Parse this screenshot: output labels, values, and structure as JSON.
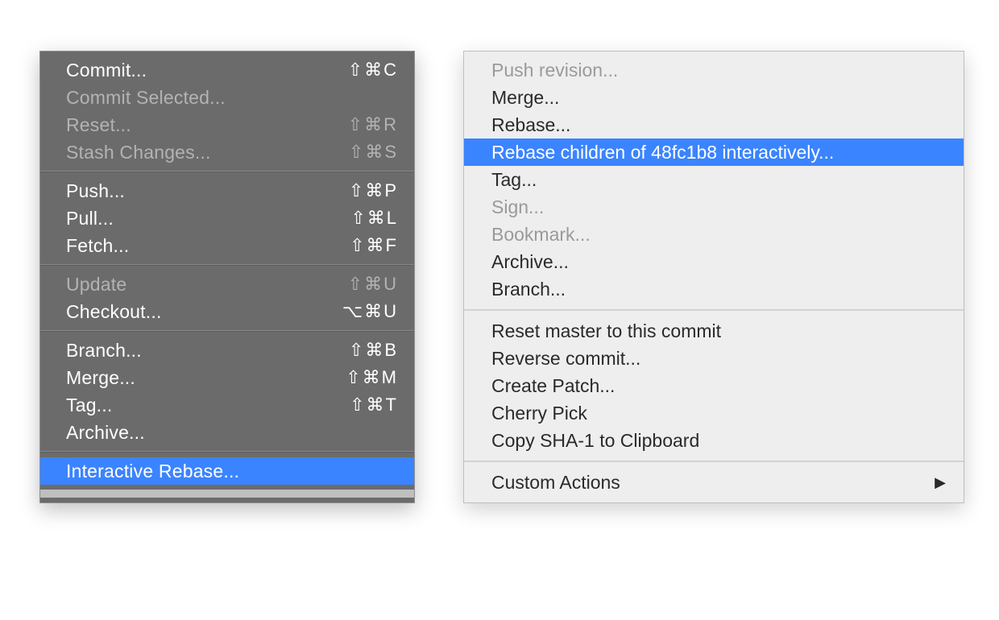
{
  "leftMenu": {
    "groups": [
      [
        {
          "key": "commit",
          "label": "Commit...",
          "shortcut": "⇧⌘C",
          "disabled": false
        },
        {
          "key": "commit-selected",
          "label": "Commit Selected...",
          "shortcut": "",
          "disabled": true
        },
        {
          "key": "reset",
          "label": "Reset...",
          "shortcut": "⇧⌘R",
          "disabled": true
        },
        {
          "key": "stash-changes",
          "label": "Stash Changes...",
          "shortcut": "⇧⌘S",
          "disabled": true
        }
      ],
      [
        {
          "key": "push",
          "label": "Push...",
          "shortcut": "⇧⌘P",
          "disabled": false
        },
        {
          "key": "pull",
          "label": "Pull...",
          "shortcut": "⇧⌘L",
          "disabled": false
        },
        {
          "key": "fetch",
          "label": "Fetch...",
          "shortcut": "⇧⌘F",
          "disabled": false
        }
      ],
      [
        {
          "key": "update",
          "label": "Update",
          "shortcut": "⇧⌘U",
          "disabled": true
        },
        {
          "key": "checkout",
          "label": "Checkout...",
          "shortcut": "⌥⌘U",
          "disabled": false
        }
      ],
      [
        {
          "key": "branch",
          "label": "Branch...",
          "shortcut": "⇧⌘B",
          "disabled": false
        },
        {
          "key": "merge",
          "label": "Merge...",
          "shortcut": "⇧⌘M",
          "disabled": false
        },
        {
          "key": "tag",
          "label": "Tag...",
          "shortcut": "⇧⌘T",
          "disabled": false
        },
        {
          "key": "archive",
          "label": "Archive...",
          "shortcut": "",
          "disabled": false
        }
      ],
      [
        {
          "key": "interactive-rebase",
          "label": "Interactive Rebase...",
          "shortcut": "",
          "disabled": false,
          "selected": true
        }
      ]
    ]
  },
  "rightMenu": {
    "groups": [
      [
        {
          "key": "push-revision",
          "label": "Push revision...",
          "disabled": true
        },
        {
          "key": "merge",
          "label": "Merge...",
          "disabled": false
        },
        {
          "key": "rebase",
          "label": "Rebase...",
          "disabled": false
        },
        {
          "key": "rebase-children-interactive",
          "label": "Rebase children of 48fc1b8 interactively...",
          "disabled": false,
          "selected": true
        },
        {
          "key": "tag",
          "label": "Tag...",
          "disabled": false
        },
        {
          "key": "sign",
          "label": "Sign...",
          "disabled": true
        },
        {
          "key": "bookmark",
          "label": "Bookmark...",
          "disabled": true
        },
        {
          "key": "archive",
          "label": "Archive...",
          "disabled": false
        },
        {
          "key": "branch",
          "label": "Branch...",
          "disabled": false
        }
      ],
      [
        {
          "key": "reset-master",
          "label": "Reset master to this commit",
          "disabled": false
        },
        {
          "key": "reverse-commit",
          "label": "Reverse commit...",
          "disabled": false
        },
        {
          "key": "create-patch",
          "label": "Create Patch...",
          "disabled": false
        },
        {
          "key": "cherry-pick",
          "label": "Cherry Pick",
          "disabled": false
        },
        {
          "key": "copy-sha1",
          "label": "Copy SHA-1 to Clipboard",
          "disabled": false
        }
      ],
      [
        {
          "key": "custom-actions",
          "label": "Custom Actions",
          "disabled": false,
          "submenu": true
        }
      ]
    ],
    "submenuArrow": "▶"
  }
}
